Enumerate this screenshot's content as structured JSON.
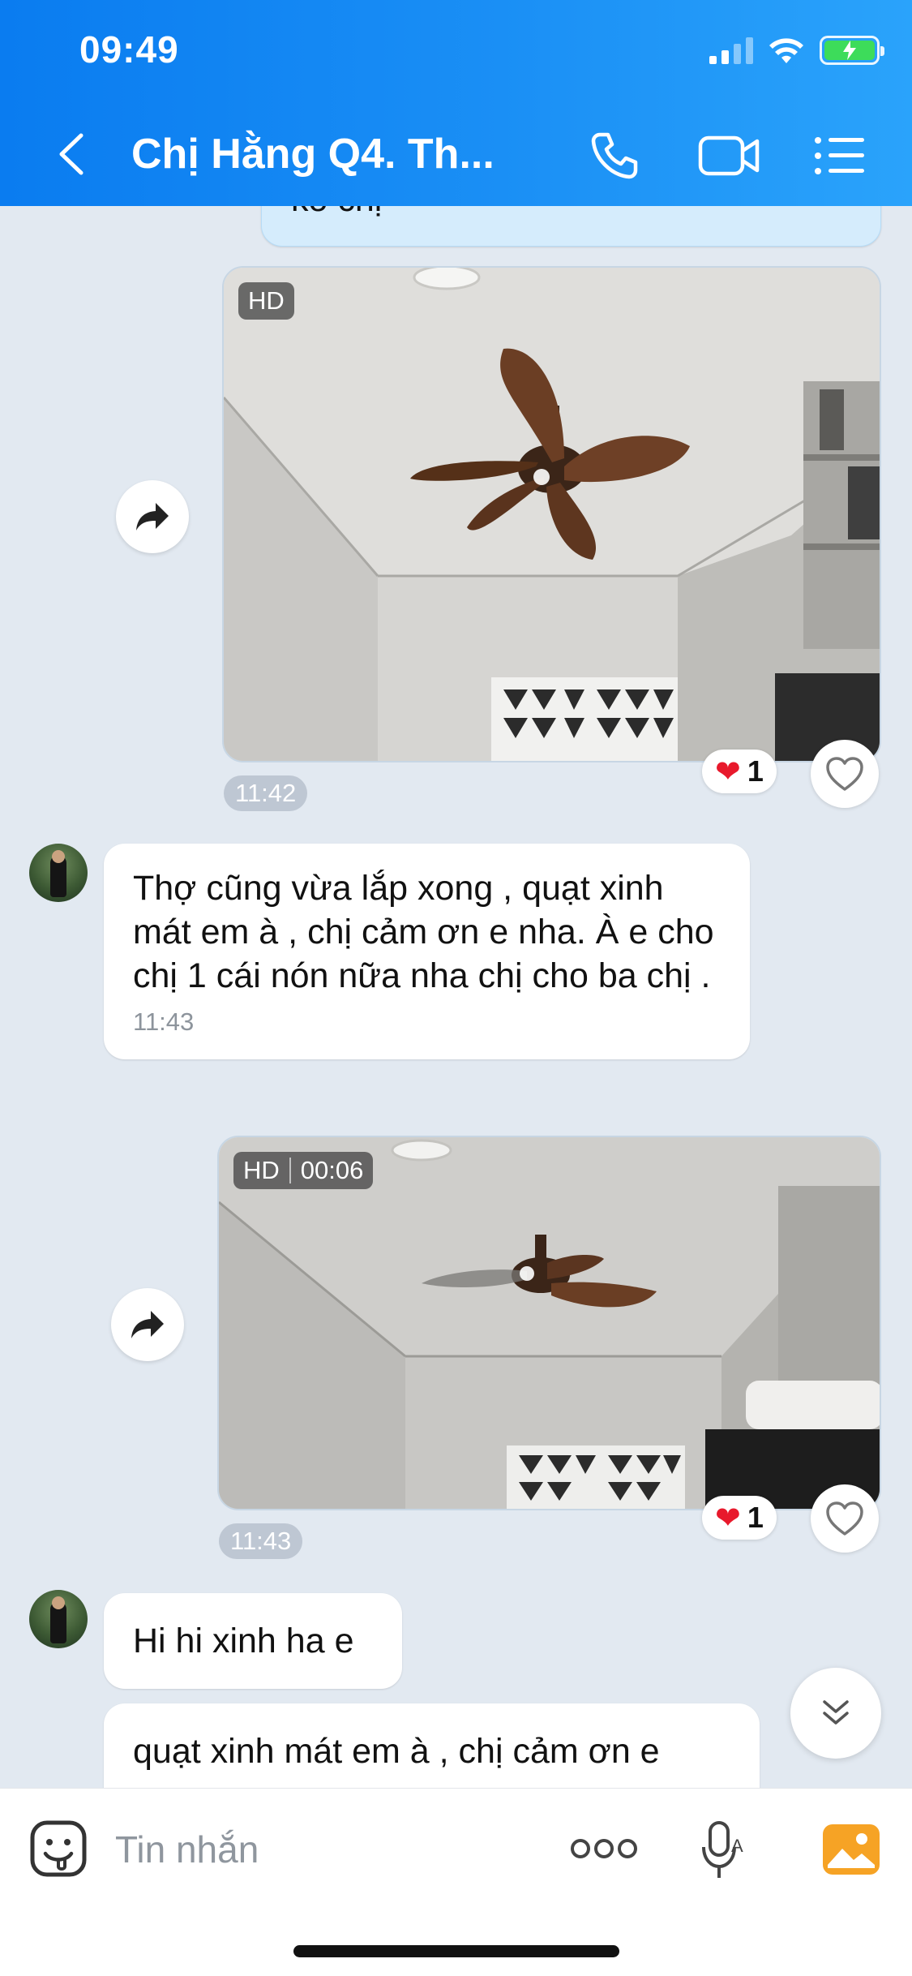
{
  "status_bar": {
    "time": "09:49"
  },
  "header": {
    "title": "Chị Hằng Q4. Th..."
  },
  "messages": {
    "partial_top_text": "ko chị",
    "image1": {
      "badge": "HD",
      "time": "11:42",
      "reaction_count": "1"
    },
    "text1": {
      "text": "Thợ cũng vừa lắp xong , quạt xinh mát em à , chị cảm ơn e nha. À e cho chị 1 cái nón nữa nha chị cho ba chị .",
      "time": "11:43"
    },
    "video1": {
      "badge": "HD",
      "duration": "00:06",
      "time": "11:43",
      "reaction_count": "1"
    },
    "text2": {
      "text": "Hi hi xinh ha e"
    },
    "text3": {
      "text": "quạt xinh mát em à , chị cảm ơn e"
    }
  },
  "input": {
    "placeholder": "Tin nhắn"
  },
  "colors": {
    "header_blue": "#0a7cf0",
    "chat_bg": "#e2e9f1",
    "heart_red": "#e8192c",
    "photo_orange": "#f6a325"
  }
}
